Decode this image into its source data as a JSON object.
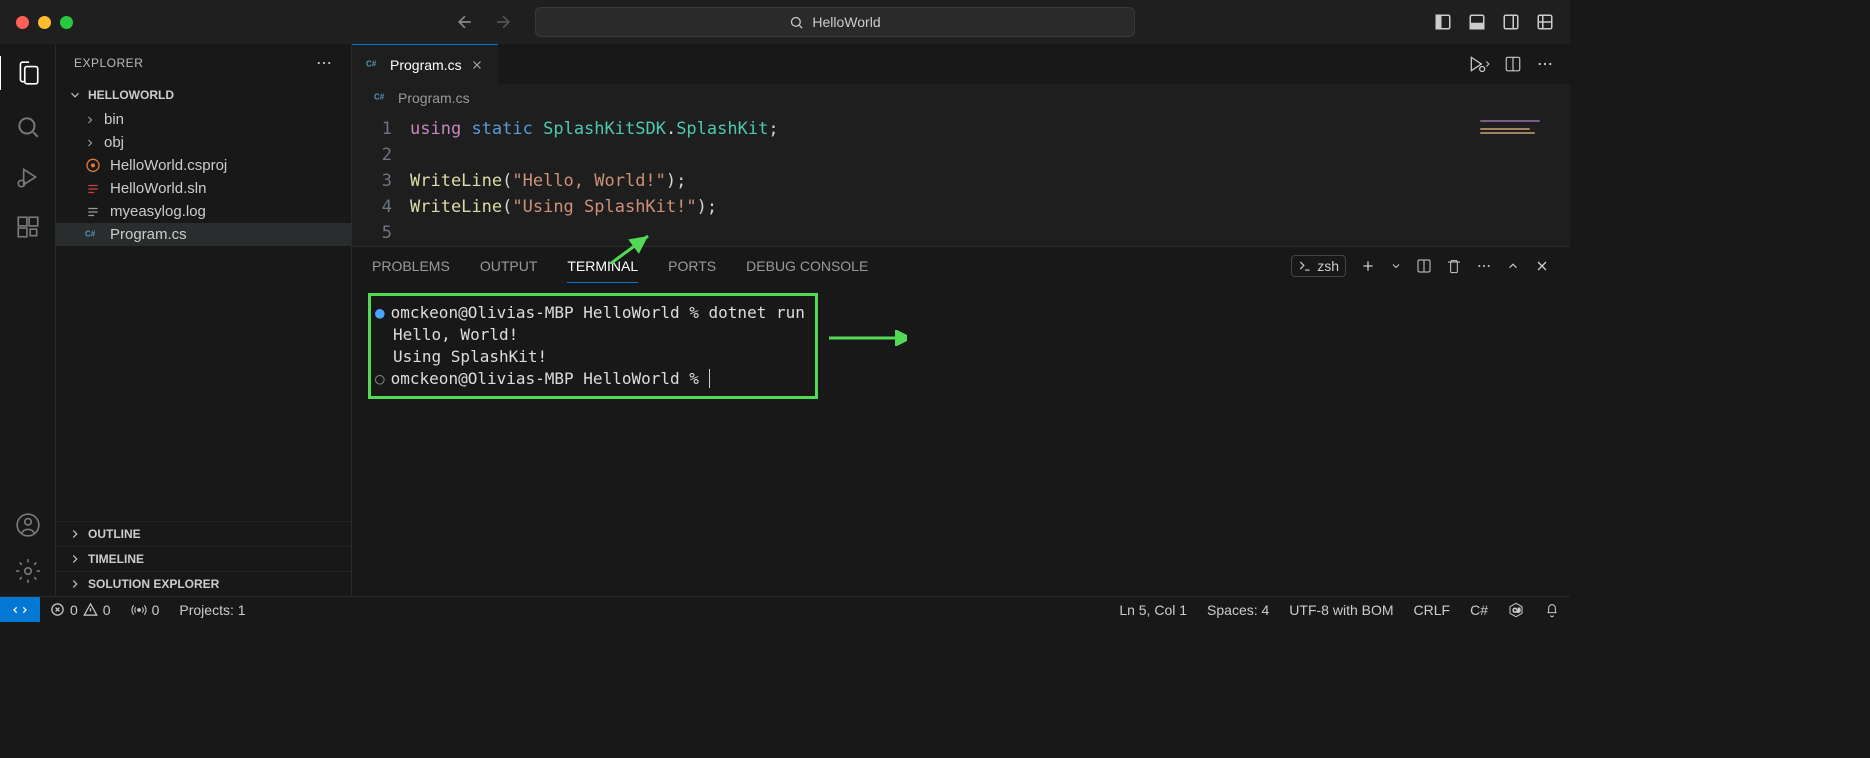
{
  "title": "HelloWorld",
  "explorer": {
    "title": "EXPLORER",
    "root": "HELLOWORLD",
    "items": [
      {
        "label": "bin",
        "type": "folder"
      },
      {
        "label": "obj",
        "type": "folder"
      },
      {
        "label": "HelloWorld.csproj",
        "type": "xml"
      },
      {
        "label": "HelloWorld.sln",
        "type": "sln"
      },
      {
        "label": "myeasylog.log",
        "type": "log"
      },
      {
        "label": "Program.cs",
        "type": "cs",
        "selected": true
      }
    ],
    "sections": [
      "OUTLINE",
      "TIMELINE",
      "SOLUTION EXPLORER"
    ]
  },
  "tab": {
    "label": "Program.cs"
  },
  "breadcrumb": "Program.cs",
  "code": {
    "lines": [
      "1",
      "2",
      "3",
      "4",
      "5"
    ],
    "l1": {
      "using": "using",
      "static": "static",
      "ns": "SplashKitSDK",
      "cls": "SplashKit"
    },
    "l3": {
      "fn": "WriteLine",
      "str": "\"Hello, World!\""
    },
    "l4": {
      "fn": "WriteLine",
      "str": "\"Using SplashKit!\""
    }
  },
  "panel": {
    "tabs": [
      "PROBLEMS",
      "OUTPUT",
      "TERMINAL",
      "PORTS",
      "DEBUG CONSOLE"
    ],
    "shell": "zsh",
    "terminal": {
      "prompt1": "omckeon@Olivias-MBP HelloWorld %",
      "cmd": "dotnet run",
      "out1": "Hello, World!",
      "out2": "Using SplashKit!",
      "prompt2": "omckeon@Olivias-MBP HelloWorld %"
    }
  },
  "status": {
    "errors": "0",
    "warnings": "0",
    "ports": "0",
    "projects": "Projects: 1",
    "pos": "Ln 5, Col 1",
    "spaces": "Spaces: 4",
    "enc": "UTF-8 with BOM",
    "eol": "CRLF",
    "lang": "C#"
  }
}
